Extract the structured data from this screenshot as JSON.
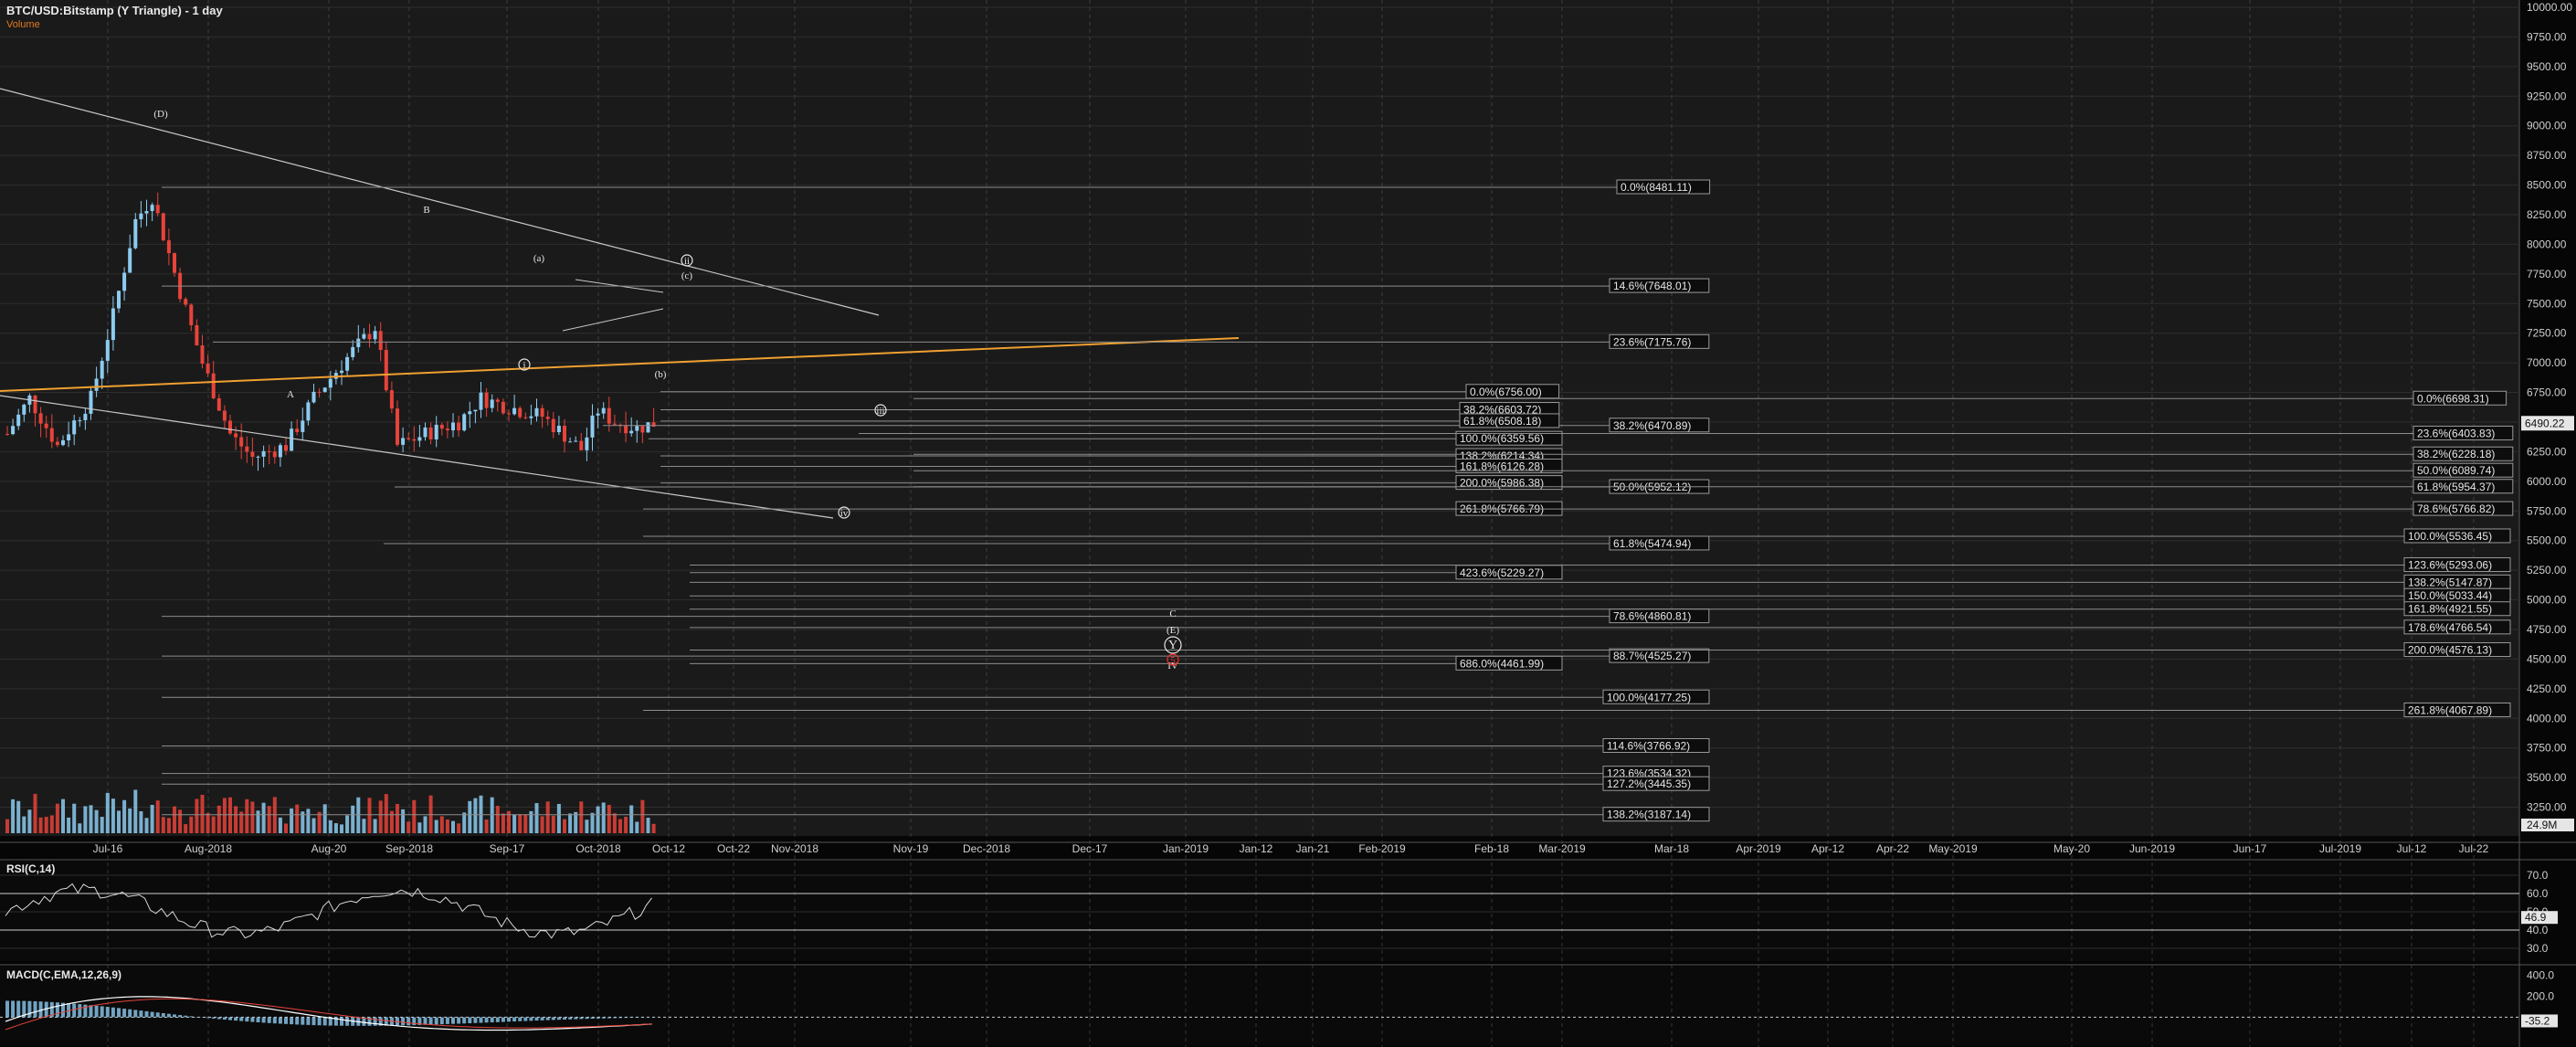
{
  "header": {
    "title": "BTC/USD:Bitstamp (Y Triangle) - 1 day",
    "volume_label": "Volume"
  },
  "colors": {
    "background": "#0b0b0b",
    "up": "#8ccbf0",
    "down": "#e8433a",
    "fib": "#8c8c8c",
    "trend": "#c8c8c8",
    "trend_orange": "#f0a030",
    "red_marker": "#ff2a2a"
  },
  "price_axis": {
    "min": 3100,
    "max": 10000,
    "ticks": [
      10000,
      9750,
      9500,
      9250,
      9000,
      8750,
      8500,
      8250,
      8000,
      7750,
      7500,
      7250,
      7000,
      6750,
      6500,
      6250,
      6000,
      5750,
      5500,
      5250,
      5000,
      4750,
      4500,
      4250,
      4000,
      3750,
      3500,
      3250
    ],
    "last_price": "6490.22",
    "volume_label": "24.9M"
  },
  "x_axis": {
    "labels": [
      "Jul-16",
      "Aug-2018",
      "Aug-20",
      "Sep-2018",
      "Sep-17",
      "Oct-2018",
      "Oct-12",
      "Oct-22",
      "Nov-2018",
      "Nov-19",
      "Dec-2018",
      "Dec-17",
      "Jan-2019",
      "Jan-12",
      "Jan-21",
      "Feb-2019",
      "Feb-18",
      "Mar-2019",
      "Mar-18",
      "Apr-2019",
      "Apr-12",
      "Apr-22",
      "May-2019",
      "May-20",
      "Jun-2019",
      "Jun-17",
      "Jul-2019",
      "Jul-12",
      "Jul-22"
    ]
  },
  "fib_levels": [
    {
      "label": "0.0%(8481.11)",
      "price": 8481.11
    },
    {
      "label": "14.6%(7648.01)",
      "price": 7648.01
    },
    {
      "label": "23.6%(7175.76)",
      "price": 7175.76
    },
    {
      "label": "38.2%(6470.89)",
      "price": 6470.89
    },
    {
      "label": "50.0%(5952.12)",
      "price": 5952.12
    },
    {
      "label": "61.8%(5474.94)",
      "price": 5474.94
    },
    {
      "label": "78.6%(4860.81)",
      "price": 4860.81
    },
    {
      "label": "88.7%(4525.27)",
      "price": 4525.27
    },
    {
      "label": "100.0%(4177.25)",
      "price": 4177.25
    },
    {
      "label": "114.6%(3766.92)",
      "price": 3766.92
    },
    {
      "label": "123.6%(3534.32)",
      "price": 3534.32
    },
    {
      "label": "127.2%(3445.35)",
      "price": 3445.35
    },
    {
      "label": "138.2%(3187.14)",
      "price": 3187.14
    },
    {
      "label": "0.0%(6756.00)",
      "price": 6756.0
    },
    {
      "label": "38.2%(6603.72)",
      "price": 6603.72
    },
    {
      "label": "61.8%(6508.18)",
      "price": 6508.18
    },
    {
      "label": "100.0%(6359.56)",
      "price": 6359.56
    },
    {
      "label": "138.2%(6214.34)",
      "price": 6214.34
    },
    {
      "label": "161.8%(6126.28)",
      "price": 6126.28
    },
    {
      "label": "200.0%(5986.38)",
      "price": 5986.38
    },
    {
      "label": "261.8%(5766.79)",
      "price": 5766.79
    },
    {
      "label": "423.6%(5229.27)",
      "price": 5229.27
    },
    {
      "label": "686.0%(4461.99)",
      "price": 4461.99
    },
    {
      "label": "0.0%(6698.31)",
      "price": 6698.31
    },
    {
      "label": "23.6%(6403.83)",
      "price": 6403.83
    },
    {
      "label": "38.2%(6228.18)",
      "price": 6228.18
    },
    {
      "label": "50.0%(6089.74)",
      "price": 6089.74
    },
    {
      "label": "61.8%(5954.37)",
      "price": 5954.37
    },
    {
      "label": "78.6%(5766.82)",
      "price": 5766.82
    },
    {
      "label": "100.0%(5536.45)",
      "price": 5536.45
    },
    {
      "label": "123.6%(5293.06)",
      "price": 5293.06
    },
    {
      "label": "138.2%(5147.87)",
      "price": 5147.87
    },
    {
      "label": "150.0%(5033.44)",
      "price": 5033.44
    },
    {
      "label": "161.8%(4921.55)",
      "price": 4921.55
    },
    {
      "label": "178.6%(4766.54)",
      "price": 4766.54
    },
    {
      "label": "200.0%(4576.13)",
      "price": 4576.13
    },
    {
      "label": "261.8%(4067.89)",
      "price": 4067.89
    }
  ],
  "wave_labels": [
    {
      "text": "(D)",
      "circled": false
    },
    {
      "text": "A",
      "circled": false
    },
    {
      "text": "B",
      "circled": false
    },
    {
      "text": "i",
      "circled": true
    },
    {
      "text": "(a)",
      "circled": false
    },
    {
      "text": "(b)",
      "circled": false
    },
    {
      "text": "(c)",
      "circled": false
    },
    {
      "text": "ii",
      "circled": true
    },
    {
      "text": "iii",
      "circled": true
    },
    {
      "text": "iv",
      "circled": true
    },
    {
      "text": "C",
      "circled": false
    },
    {
      "text": "(E)",
      "circled": false
    },
    {
      "text": "Y",
      "circled": true
    },
    {
      "text": "IV",
      "circled": false
    },
    {
      "text": "5",
      "circled": true
    }
  ],
  "rsi": {
    "label": "RSI(C,14)",
    "ticks": [
      70.0,
      60.0,
      50.0,
      40.0,
      30.0
    ],
    "current": "46.9"
  },
  "macd": {
    "label": "MACD(C,EMA,12,26,9)",
    "ticks": [
      400.0,
      200.0
    ],
    "current": "-35.2"
  },
  "chart_data": {
    "type": "line",
    "title": "BTC/USD:Bitstamp (Y Triangle) - 1 day",
    "xlabel": "",
    "ylabel": "",
    "ylim": [
      3100,
      10000
    ],
    "grid": true,
    "x": [
      "2018-07-01",
      "2018-07-05",
      "2018-07-10",
      "2018-07-16",
      "2018-07-20",
      "2018-07-24",
      "2018-07-27",
      "2018-08-01",
      "2018-08-05",
      "2018-08-10",
      "2018-08-14",
      "2018-08-20",
      "2018-08-25",
      "2018-09-01",
      "2018-09-05",
      "2018-09-09",
      "2018-09-14",
      "2018-09-20",
      "2018-09-24",
      "2018-10-01",
      "2018-10-05",
      "2018-10-10",
      "2018-10-12",
      "2018-10-15",
      "2018-10-18",
      "2018-10-22",
      "2018-10-25"
    ],
    "series": [
      {
        "values": [
          6400,
          6700,
          6300,
          6700,
          7400,
          8200,
          8400,
          7600,
          7000,
          6400,
          6200,
          6300,
          6700,
          7100,
          7300,
          6300,
          6400,
          6500,
          6700,
          6600,
          6550,
          6350,
          6270,
          6600,
          6500,
          6450,
          6490
        ]
      }
    ]
  }
}
